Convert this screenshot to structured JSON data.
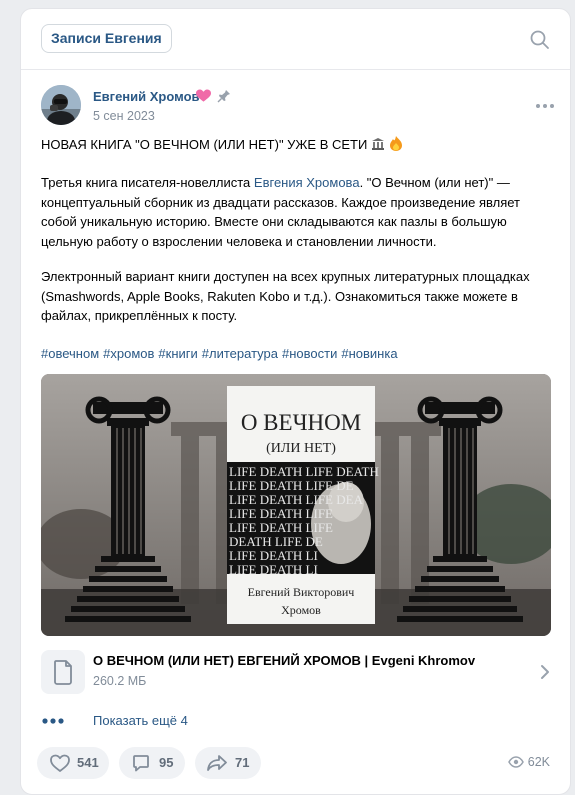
{
  "header": {
    "chip_label": "Записи Евгения"
  },
  "post": {
    "author": "Евгений Хромов",
    "date": "5 сен 2023",
    "title_line": "НОВАЯ КНИГА \"О ВЕЧНОМ (ИЛИ НЕТ)\" УЖЕ В СЕТИ",
    "p1_prefix": "Третья книга писателя-новеллиста ",
    "p1_link": "Евгения Хромова",
    "p1_suffix": ". \"О Вечном (или нет)\" — концептуальный сборник из двадцати рассказов. Каждое произведение являет собой уникальную историю. Вместе они складываются как пазлы в большую цельную работу о взрослении человека и становлении личности.",
    "p2": "Электронный вариант книги доступен на всех крупных литературных площадках (Smashwords, Apple Books, Rakuten Kobo и т.д.). Ознакомиться также можете в файлах, прикреплённых к посту.",
    "hashtags": [
      "#овечном",
      "#хромов",
      "#книги",
      "#литература",
      "#новости",
      "#новинка"
    ]
  },
  "cover": {
    "title": "О ВЕЧНОМ",
    "subtitle": "(ИЛИ НЕТ)",
    "pattern_lines": [
      "LIFE DEATH LIFE DEATH",
      "LIFE DEATH LIFE DE",
      "LIFE DEATH LIFE DEA",
      "LIFE DEATH LIFE",
      "LIFE DEATH LIFE",
      "DEATH LIFE DE",
      "LIFE DEATH LI",
      "LIFE DEATH LI"
    ],
    "author_line1": "Евгений Викторович",
    "author_line2": "Хромов"
  },
  "attachment": {
    "name": "О ВЕЧНОМ (ИЛИ НЕТ) ЕВГЕНИЙ ХРОМОВ | Evgeni Khromov",
    "size": "260.2 МБ"
  },
  "show_more": "Показать ещё 4",
  "actions": {
    "likes": "541",
    "comments": "95",
    "shares": "71",
    "views": "62K"
  },
  "icons": [
    "search-icon",
    "heart-emoji",
    "pin-icon",
    "more-icon",
    "classical-building-emoji",
    "fire-emoji",
    "file-icon",
    "chevron-right-icon",
    "dots-icon",
    "heart-icon",
    "comment-icon",
    "share-icon",
    "eye-icon"
  ],
  "colors": {
    "link": "#2a5885",
    "muted": "#818c99",
    "pill": "#f0f2f5"
  }
}
